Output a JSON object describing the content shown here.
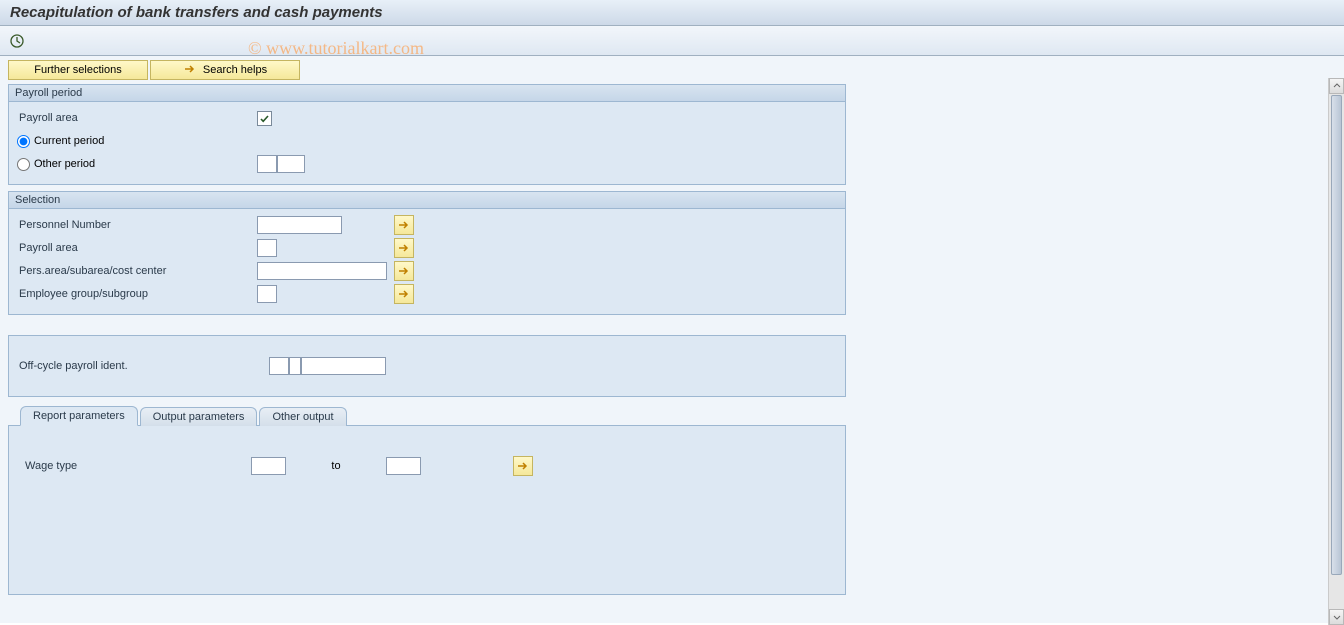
{
  "title": "Recapitulation of bank transfers and cash payments",
  "watermark": "© www.tutorialkart.com",
  "buttons": {
    "further_selections": "Further selections",
    "search_helps": "Search helps"
  },
  "groups": {
    "payroll_period": {
      "title": "Payroll period",
      "payroll_area_label": "Payroll area",
      "current_period": "Current period",
      "other_period": "Other period"
    },
    "selection": {
      "title": "Selection",
      "personnel_number": "Personnel Number",
      "payroll_area": "Payroll area",
      "pers_area": "Pers.area/subarea/cost center",
      "employee_group": "Employee group/subgroup"
    },
    "offcycle": {
      "label": "Off-cycle payroll ident."
    }
  },
  "tabs": {
    "report": "Report parameters",
    "output": "Output parameters",
    "other": "Other output",
    "wage_type": "Wage type",
    "to": "to"
  }
}
